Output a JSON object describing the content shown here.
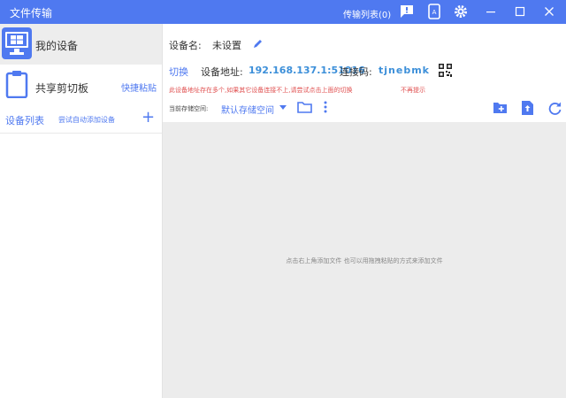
{
  "app": {
    "title": "文件传输",
    "transfer_list": "传输列表(0)"
  },
  "titlebar_icons": [
    "message-icon",
    "phone-icon",
    "gear-icon",
    "minimize-icon",
    "maximize-icon",
    "close-icon"
  ],
  "sidebar": {
    "my_device": "我的设备",
    "clipboard": "共享剪切板",
    "quick_paste": "快捷粘贴",
    "device_list": "设备列表",
    "auto_add": "尝试自动添加设备",
    "add": "+"
  },
  "device": {
    "name_label": "设备名:",
    "name_value": "未设置",
    "switch": "切换",
    "address_label": "设备地址:",
    "address_value": "192.168.137.1:51016",
    "code_label": "连接码:",
    "code_value": "tjnebmk",
    "warning": "此设备地址存在多个,如果其它设备连接不上,请尝试点击上面的切换",
    "dismiss": "不再提示",
    "storage_label": "当前存储空间:",
    "storage_value": "默认存储空间"
  },
  "files": {
    "empty_hint": "点击右上角添加文件 也可以用拖拽粘贴的方式来添加文件"
  },
  "colors": {
    "accent": "#4f79f0",
    "warning": "#e05050",
    "selected_bg": "#ededed"
  }
}
